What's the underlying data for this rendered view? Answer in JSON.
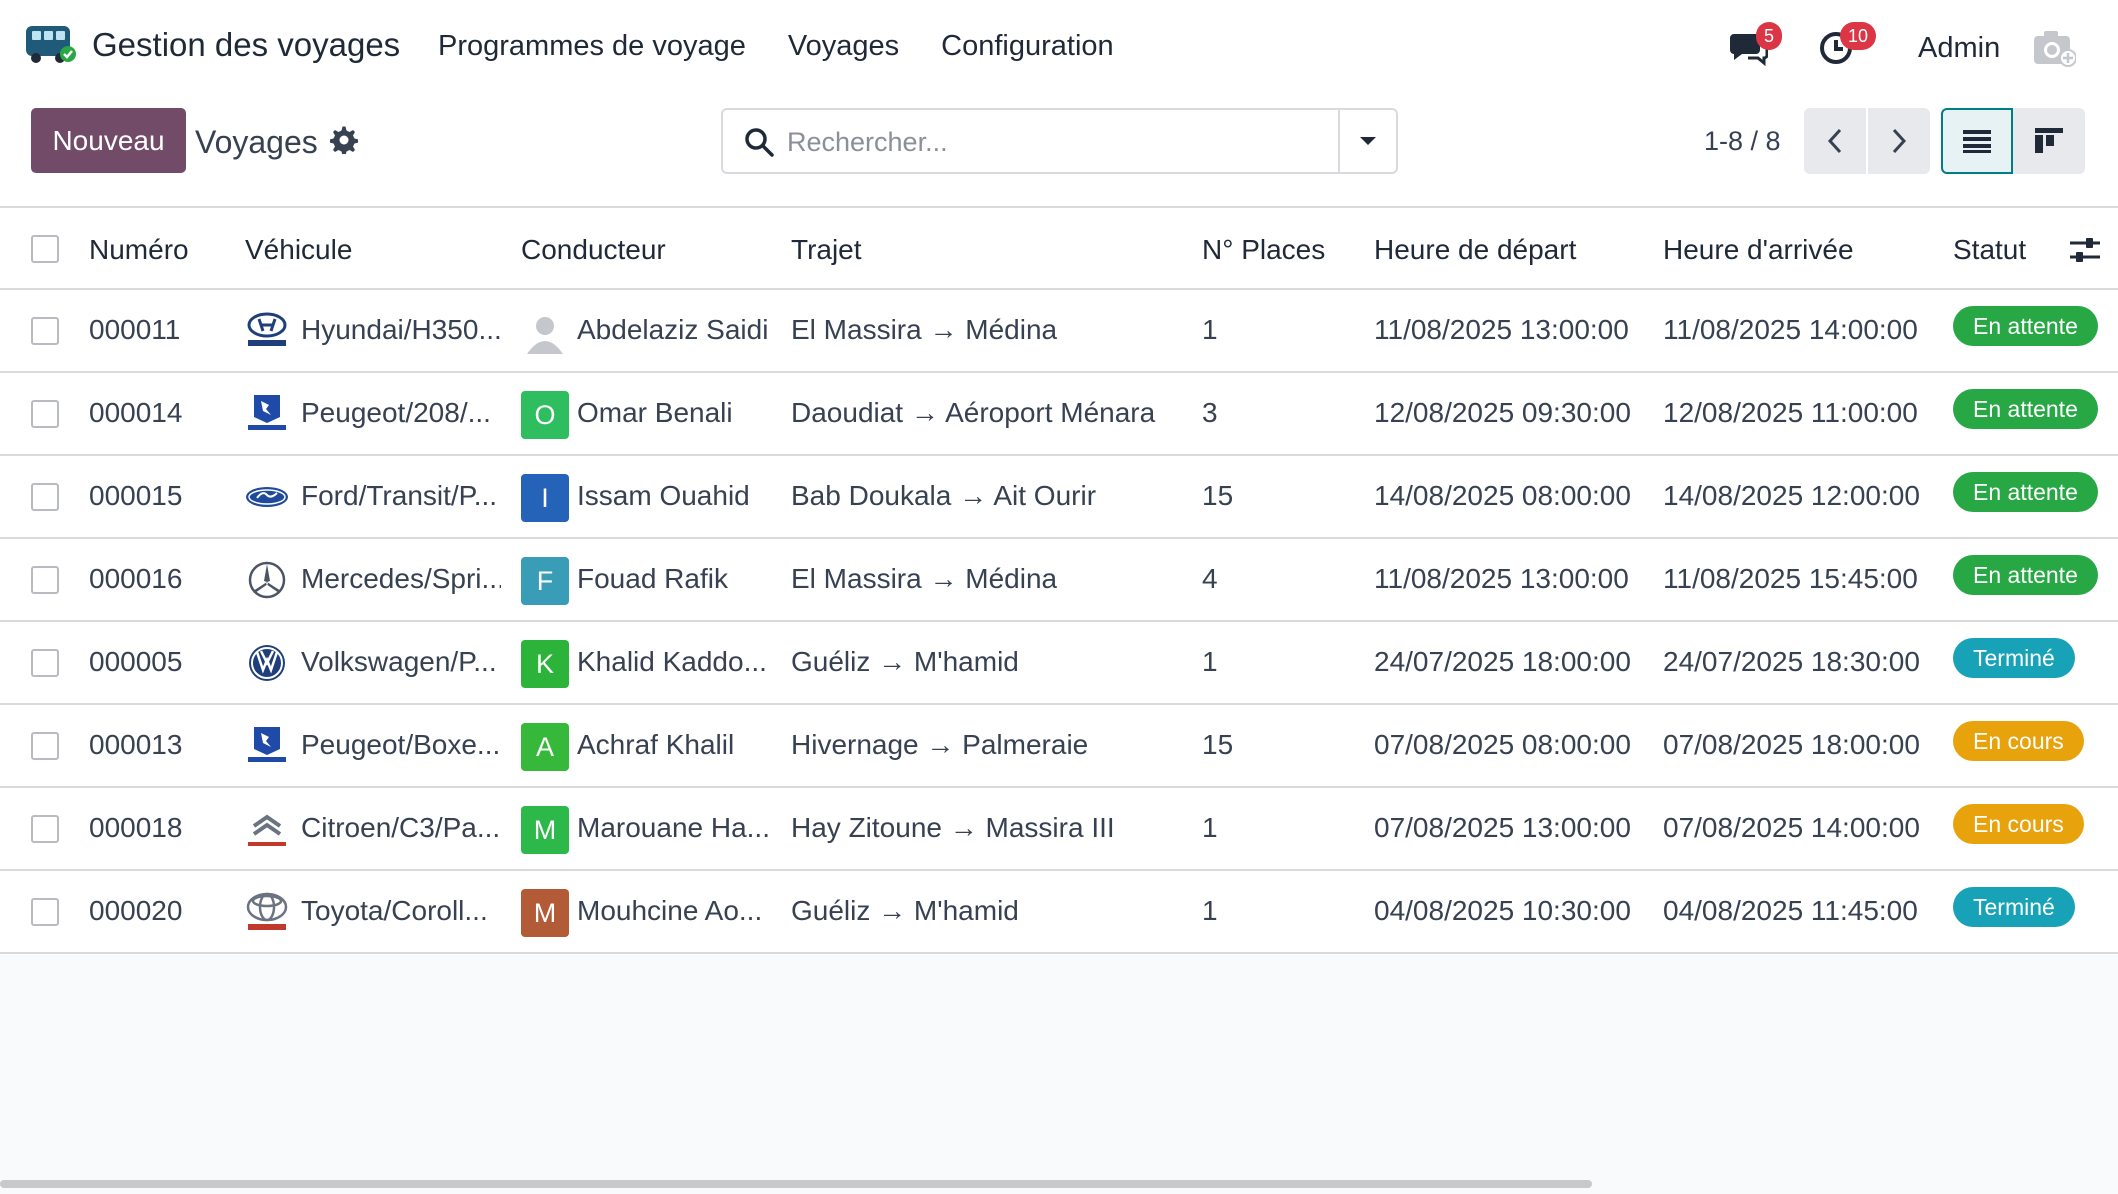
{
  "navbar": {
    "app_name": "Gestion des voyages",
    "menu": [
      "Programmes de voyage",
      "Voyages",
      "Configuration"
    ],
    "messages_count": "5",
    "activities_count": "10",
    "user_name": "Admin"
  },
  "control_panel": {
    "new_label": "Nouveau",
    "title": "Voyages",
    "search_placeholder": "Rechercher...",
    "pager": "1-8 / 8"
  },
  "table": {
    "headers": [
      "Numéro",
      "Véhicule",
      "Conducteur",
      "Trajet",
      "N° Places",
      "Heure de départ",
      "Heure d'arrivée",
      "Statut"
    ],
    "rows": [
      {
        "numero": "000011",
        "vehicule": "Hyundai/H350...",
        "brand": "hyundai-logo-icon",
        "conducteur": "Abdelaziz Saidi",
        "initial": "",
        "avatar_color": "",
        "trajet": "El Massira → Médina",
        "places": "1",
        "depart": "11/08/2025 13:00:00",
        "arrivee": "11/08/2025 14:00:00",
        "statut": "En attente",
        "statut_color": "#28a745"
      },
      {
        "numero": "000014",
        "vehicule": "Peugeot/208/...",
        "brand": "peugeot-logo-icon",
        "conducteur": "Omar Benali",
        "initial": "O",
        "avatar_color": "#2fbe5f",
        "trajet": "Daoudiat → Aéroport Ménara",
        "places": "3",
        "depart": "12/08/2025 09:30:00",
        "arrivee": "12/08/2025 11:00:00",
        "statut": "En attente",
        "statut_color": "#28a745"
      },
      {
        "numero": "000015",
        "vehicule": "Ford/Transit/P...",
        "brand": "ford-logo-icon",
        "conducteur": "Issam Ouahid",
        "initial": "I",
        "avatar_color": "#2563b8",
        "trajet": "Bab Doukala → Ait Ourir",
        "places": "15",
        "depart": "14/08/2025 08:00:00",
        "arrivee": "14/08/2025 12:00:00",
        "statut": "En attente",
        "statut_color": "#28a745"
      },
      {
        "numero": "000016",
        "vehicule": "Mercedes/Spri...",
        "brand": "mercedes-logo-icon",
        "conducteur": "Fouad Rafik",
        "initial": "F",
        "avatar_color": "#3a9db8",
        "trajet": "El Massira → Médina",
        "places": "4",
        "depart": "11/08/2025 13:00:00",
        "arrivee": "11/08/2025 15:45:00",
        "statut": "En attente",
        "statut_color": "#28a745"
      },
      {
        "numero": "000005",
        "vehicule": "Volkswagen/P...",
        "brand": "volkswagen-logo-icon",
        "conducteur": "Khalid Kaddo...",
        "initial": "K",
        "avatar_color": "#2bb33a",
        "trajet": "Guéliz → M'hamid",
        "places": "1",
        "depart": "24/07/2025 18:00:00",
        "arrivee": "24/07/2025 18:30:00",
        "statut": "Terminé",
        "statut_color": "#17a2b8"
      },
      {
        "numero": "000013",
        "vehicule": "Peugeot/Boxe...",
        "brand": "peugeot-logo-icon",
        "conducteur": "Achraf Khalil",
        "initial": "A",
        "avatar_color": "#36b83a",
        "trajet": "Hivernage → Palmeraie",
        "places": "15",
        "depart": "07/08/2025 08:00:00",
        "arrivee": "07/08/2025 18:00:00",
        "statut": "En cours",
        "statut_color": "#e8a20c"
      },
      {
        "numero": "000018",
        "vehicule": "Citroen/C3/Pa...",
        "brand": "citroen-logo-icon",
        "conducteur": "Marouane Ha...",
        "initial": "M",
        "avatar_color": "#2db84a",
        "trajet": "Hay Zitoune → Massira III",
        "places": "1",
        "depart": "07/08/2025 13:00:00",
        "arrivee": "07/08/2025 14:00:00",
        "statut": "En cours",
        "statut_color": "#e8a20c"
      },
      {
        "numero": "000020",
        "vehicule": "Toyota/Coroll...",
        "brand": "toyota-logo-icon",
        "conducteur": "Mouhcine Ao...",
        "initial": "M",
        "avatar_color": "#b35a36",
        "trajet": "Guéliz → M'hamid",
        "places": "1",
        "depart": "04/08/2025 10:30:00",
        "arrivee": "04/08/2025 11:45:00",
        "statut": "Terminé",
        "statut_color": "#17a2b8"
      }
    ]
  },
  "colors": {
    "primary": "#714b67",
    "badge": "#dc3545"
  }
}
